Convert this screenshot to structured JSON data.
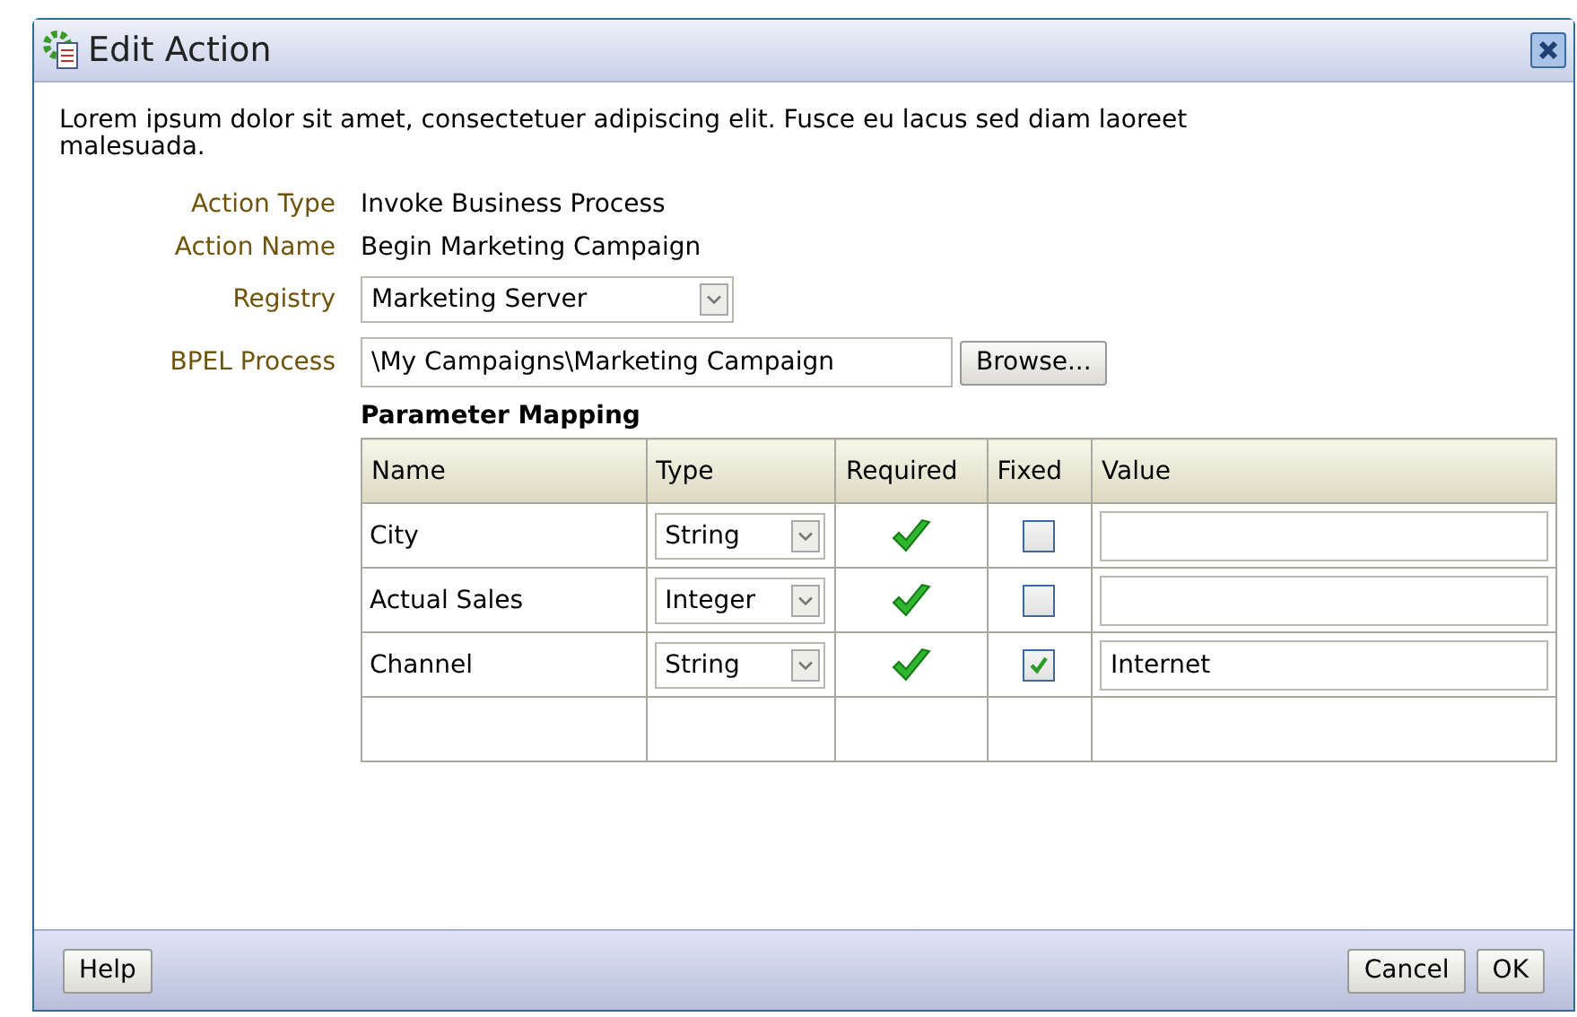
{
  "window": {
    "title": "Edit Action"
  },
  "description": "Lorem ipsum dolor sit amet, consectetuer adipiscing elit. Fusce eu lacus sed diam laoreet malesuada.",
  "fields": [
    {
      "label": "Action Type",
      "kind": "text",
      "value": "Invoke Business Process"
    },
    {
      "label": "Action Name",
      "kind": "text",
      "value": "Begin Marketing Campaign"
    },
    {
      "label": "Registry",
      "kind": "select",
      "value": "Marketing Server"
    },
    {
      "label": "BPEL Process",
      "kind": "input",
      "value": "\\My Campaigns\\Marketing Campaign",
      "button": "Browse..."
    }
  ],
  "parameter_mapping": {
    "title": "Parameter Mapping",
    "columns": [
      "Name",
      "Type",
      "Required",
      "Fixed",
      "Value"
    ],
    "rows": [
      {
        "name": "City",
        "type": "String",
        "required": true,
        "fixed": false,
        "value": ""
      },
      {
        "name": "Actual Sales",
        "type": "Integer",
        "required": true,
        "fixed": false,
        "value": ""
      },
      {
        "name": "Channel",
        "type": "String",
        "required": true,
        "fixed": true,
        "value": "Internet"
      }
    ]
  },
  "footer": {
    "help": "Help",
    "buttons": [
      "Cancel",
      "OK"
    ]
  }
}
